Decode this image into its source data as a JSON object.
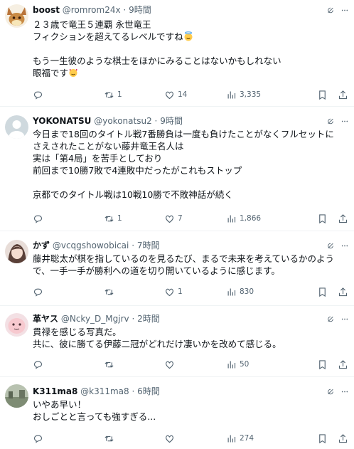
{
  "posts": [
    {
      "name": "boost",
      "handle": "@romrom24x",
      "dot": "·",
      "time": "9時間",
      "lines": [
        "２３歳で竜王５連覇 永世竜王",
        "フィクションを超えてるレベルですね",
        "",
        "もう一生彼のような棋士をほかにみることはないかもしれない",
        "眼福です"
      ],
      "emoji_line2": "innocent-face",
      "emoji_line5": "smiling-face-with-hearts",
      "replies": "",
      "retweets": "1",
      "likes": "14",
      "views": "3,335"
    },
    {
      "name": "YOKONATSU",
      "handle": "@yokonatsu2",
      "dot": "·",
      "time": "9時間",
      "lines": [
        "今日まで18回のタイトル戦7番勝負は一度も負けたことがなくフルセットに",
        "さえされたことがない藤井竜王名人は",
        "実は「第4局」を苦手としており",
        "前回まで10勝7敗で4連敗中だったがこれもストップ",
        "",
        "京都でのタイトル戦は10戦10勝で不敗神話が続く"
      ],
      "replies": "",
      "retweets": "1",
      "likes": "7",
      "views": "1,866"
    },
    {
      "name": "かず",
      "handle": "@vcqgshowobicai",
      "dot": "·",
      "time": "7時間",
      "lines": [
        "藤井聡太が棋を指しているのを見るたび、まるで未来を考えているかのよう",
        "で、一手一手が勝利への道を切り開いているように感じます。"
      ],
      "replies": "",
      "retweets": "",
      "likes": "1",
      "views": "830"
    },
    {
      "name": "革ヤス",
      "handle": "@Ncky_D_Mgjrv",
      "dot": "·",
      "time": "2時間",
      "lines": [
        "貫禄を感じる写真だ。",
        "共に、彼に勝てる伊藤二冠がどれだけ凄いかを改めて感じる。"
      ],
      "replies": "",
      "retweets": "",
      "likes": "",
      "views": "50"
    },
    {
      "name": "K311ma8",
      "handle": "@k311ma8",
      "dot": "·",
      "time": "6時間",
      "lines": [
        "いやあ早い！",
        "おしごとと言っても強すぎる..."
      ],
      "replies": "",
      "retweets": "",
      "likes": "",
      "views": "274"
    }
  ],
  "icons": {
    "reply": "reply-icon",
    "retweet": "retweet-icon",
    "like": "heart-icon",
    "views": "views-icon",
    "bookmark": "bookmark-icon",
    "share": "share-icon",
    "grok": "grok-icon",
    "more": "more-icon"
  },
  "colors": {
    "text": "#0f1419",
    "secondary": "#536471",
    "border": "#eff3f4"
  }
}
